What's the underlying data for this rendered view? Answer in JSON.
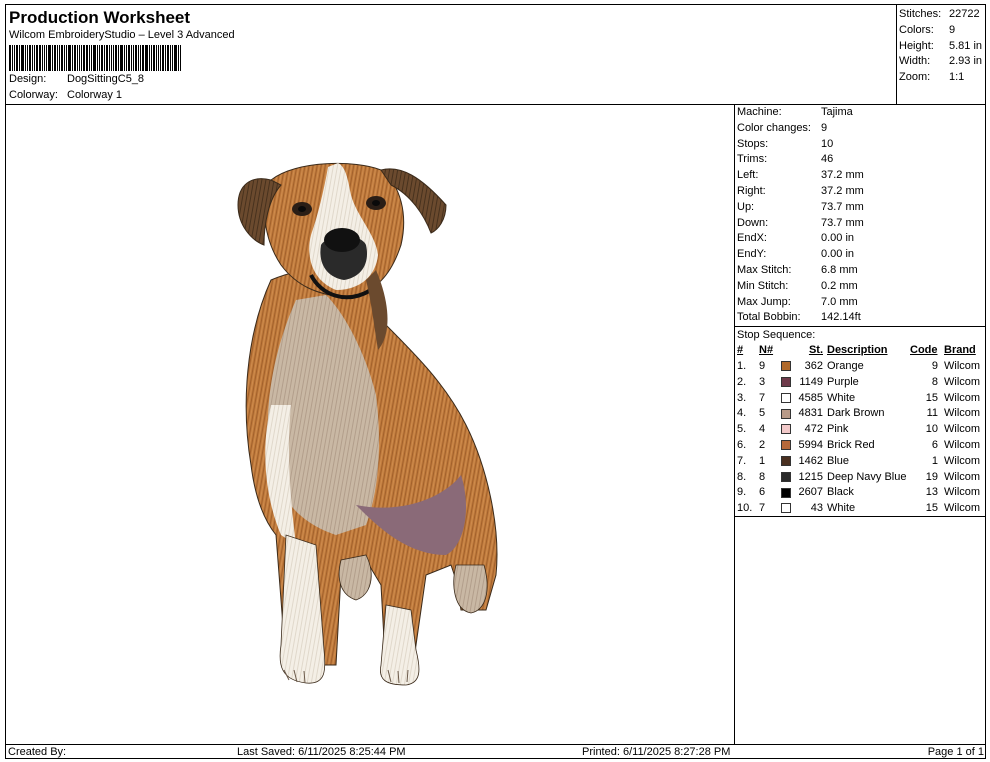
{
  "header": {
    "title": "Production Worksheet",
    "subtitle": "Wilcom EmbroideryStudio – Level 3 Advanced",
    "design_label": "Design:",
    "design_value": "DogSittingC5_8",
    "colorway_label": "Colorway:",
    "colorway_value": "Colorway 1"
  },
  "stats": [
    {
      "label": "Stitches:",
      "value": "22722"
    },
    {
      "label": "Colors:",
      "value": "9"
    },
    {
      "label": "Height:",
      "value": "5.81 in"
    },
    {
      "label": "Width:",
      "value": "2.93 in"
    },
    {
      "label": "Zoom:",
      "value": "1:1"
    }
  ],
  "machine_info": [
    {
      "label": "Machine:",
      "value": "Tajima"
    },
    {
      "label": "Color changes:",
      "value": "9"
    },
    {
      "label": "Stops:",
      "value": "10"
    },
    {
      "label": "Trims:",
      "value": "46"
    },
    {
      "label": "Left:",
      "value": "37.2 mm"
    },
    {
      "label": "Right:",
      "value": "37.2 mm"
    },
    {
      "label": "Up:",
      "value": "73.7 mm"
    },
    {
      "label": "Down:",
      "value": "73.7 mm"
    },
    {
      "label": "EndX:",
      "value": "0.00 in"
    },
    {
      "label": "EndY:",
      "value": "0.00 in"
    },
    {
      "label": "Max Stitch:",
      "value": "6.8 mm"
    },
    {
      "label": "Min Stitch:",
      "value": "0.2 mm"
    },
    {
      "label": "Max Jump:",
      "value": "7.0 mm"
    },
    {
      "label": "Total Bobbin:",
      "value": "142.14ft"
    }
  ],
  "stop_sequence": {
    "title": "Stop Sequence:",
    "headers": {
      "num": "#",
      "n": "N#",
      "st": "St.",
      "desc": "Description",
      "code": "Code",
      "brand": "Brand"
    },
    "rows": [
      {
        "num": "1.",
        "n": "9",
        "color": "#b06a2c",
        "st": "362",
        "desc": "Orange",
        "code": "9",
        "brand": "Wilcom"
      },
      {
        "num": "2.",
        "n": "3",
        "color": "#6e3a4a",
        "st": "1149",
        "desc": "Purple",
        "code": "8",
        "brand": "Wilcom"
      },
      {
        "num": "3.",
        "n": "7",
        "color": "#ffffff",
        "st": "4585",
        "desc": "White",
        "code": "15",
        "brand": "Wilcom"
      },
      {
        "num": "4.",
        "n": "5",
        "color": "#b89a88",
        "st": "4831",
        "desc": "Dark Brown",
        "code": "11",
        "brand": "Wilcom"
      },
      {
        "num": "5.",
        "n": "4",
        "color": "#f2c9c9",
        "st": "472",
        "desc": "Pink",
        "code": "10",
        "brand": "Wilcom"
      },
      {
        "num": "6.",
        "n": "2",
        "color": "#b5683a",
        "st": "5994",
        "desc": "Brick Red",
        "code": "6",
        "brand": "Wilcom"
      },
      {
        "num": "7.",
        "n": "1",
        "color": "#4a3020",
        "st": "1462",
        "desc": "Blue",
        "code": "1",
        "brand": "Wilcom"
      },
      {
        "num": "8.",
        "n": "8",
        "color": "#2a2a2a",
        "st": "1215",
        "desc": "Deep Navy Blue",
        "code": "19",
        "brand": "Wilcom"
      },
      {
        "num": "9.",
        "n": "6",
        "color": "#000000",
        "st": "2607",
        "desc": "Black",
        "code": "13",
        "brand": "Wilcom"
      },
      {
        "num": "10.",
        "n": "7",
        "color": "#ffffff",
        "st": "43",
        "desc": "White",
        "code": "15",
        "brand": "Wilcom"
      }
    ]
  },
  "footer": {
    "created_by": "Created By:",
    "last_saved": "Last Saved: 6/11/2025 8:25:44 PM",
    "printed": "Printed: 6/11/2025 8:27:28 PM",
    "page": "Page 1 of 1"
  }
}
